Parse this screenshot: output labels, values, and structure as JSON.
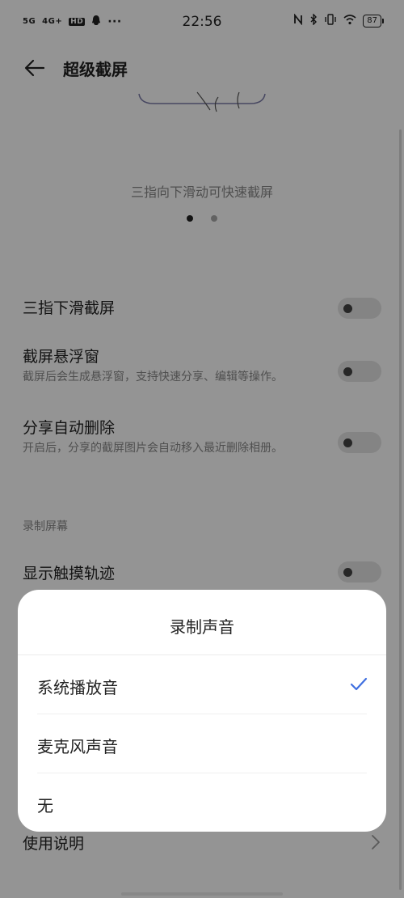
{
  "status_bar": {
    "sim1": "5G",
    "sim2": "4G+",
    "hd": "HD",
    "more": "···",
    "time": "22:56",
    "battery": "87",
    "icons": [
      "signal-icon",
      "signal-icon",
      "hd-voice-icon",
      "qq-icon",
      "nfc-icon",
      "bluetooth-icon",
      "vibrate-icon",
      "wifi-icon",
      "battery-icon"
    ]
  },
  "header": {
    "title": "超级截屏",
    "back_icon": "back-arrow-icon"
  },
  "hero": {
    "hint": "三指向下滑动可快速截屏"
  },
  "settings": [
    {
      "title": "三指下滑截屏",
      "desc": "",
      "enabled": false
    },
    {
      "title": "截屏悬浮窗",
      "desc": "截屏后会生成悬浮窗，支持快速分享、编辑等操作。",
      "enabled": false
    },
    {
      "title": "分享自动删除",
      "desc": "开启后，分享的截屏图片会自动移入最近删除相册。",
      "enabled": false
    }
  ],
  "record_section": {
    "header": "录制屏幕",
    "show_touch": {
      "title": "显示触摸轨迹",
      "enabled": false
    }
  },
  "help": {
    "label": "使用说明"
  },
  "dialog": {
    "title": "录制声音",
    "options": [
      {
        "label": "系统播放音",
        "selected": true
      },
      {
        "label": "麦克风声音",
        "selected": false
      },
      {
        "label": "无",
        "selected": false
      }
    ],
    "accent": "#3f6fe0"
  }
}
